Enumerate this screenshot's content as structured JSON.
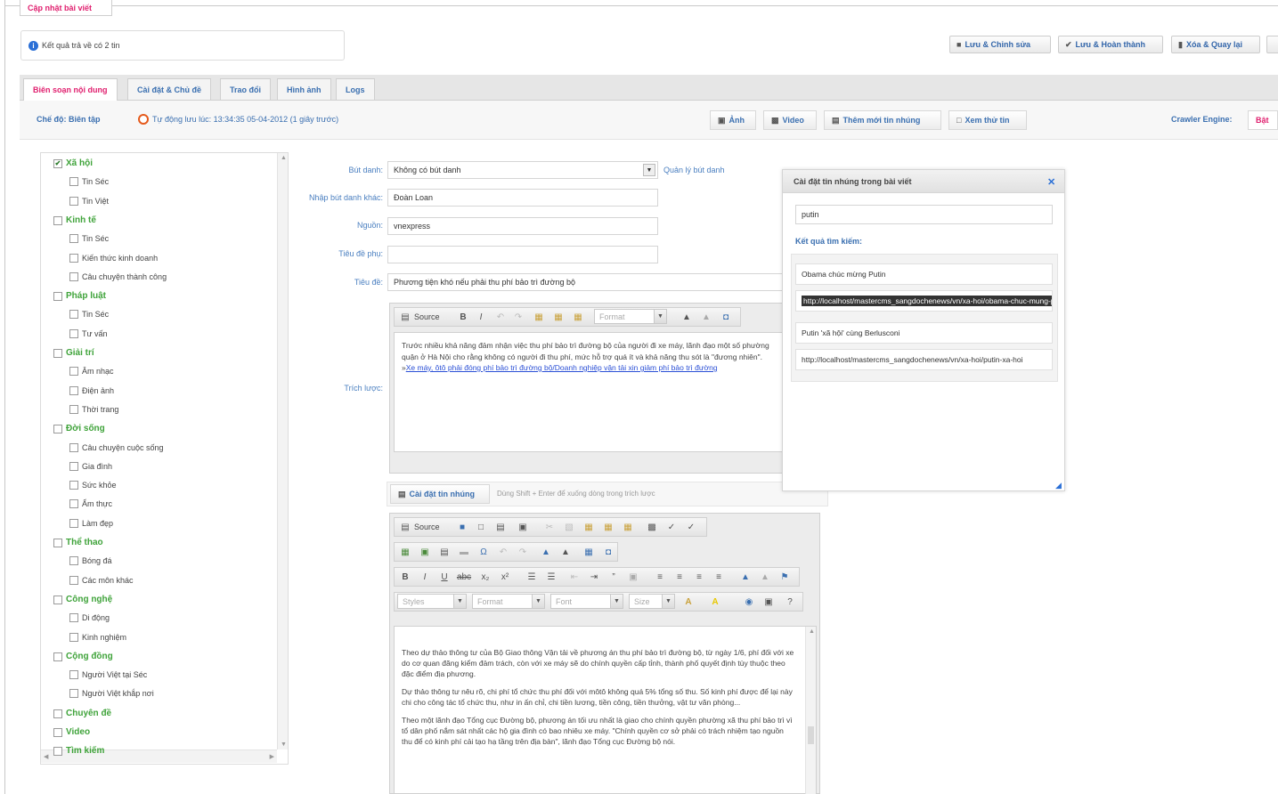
{
  "header": {
    "title": "Cập nhật bài viết"
  },
  "notice": {
    "text": "Kết quả trả về có 2 tin"
  },
  "actions": {
    "save_edit": "Lưu & Chỉnh sửa",
    "save_done": "Lưu & Hoàn thành",
    "delete_back": "Xóa & Quay lại"
  },
  "tabs": [
    {
      "label": "Biên soạn nội dung"
    },
    {
      "label": "Cài đặt & Chủ đề"
    },
    {
      "label": "Trao đổi"
    },
    {
      "label": "Hình ảnh"
    },
    {
      "label": "Logs"
    }
  ],
  "toolbar": {
    "mode_label": "Chế độ: Biên tập",
    "autosave": "Tự động lưu lúc: 13:34:35 05-04-2012 (1 giây trước)",
    "image_btn": "Ảnh",
    "video_btn": "Video",
    "add_embed_btn": "Thêm mới tin nhúng",
    "preview_btn": "Xem thử tin",
    "crawler_label": "Crawler Engine:",
    "crawler_state": "Bật"
  },
  "categories": [
    {
      "label": "Xã hội",
      "level": 0,
      "checked": true
    },
    {
      "label": "Tin Séc",
      "level": 1
    },
    {
      "label": "Tin Việt",
      "level": 1
    },
    {
      "label": "Kinh tế",
      "level": 0
    },
    {
      "label": "Tin Séc",
      "level": 1
    },
    {
      "label": "Kiến thức kinh doanh",
      "level": 1
    },
    {
      "label": "Câu chuyện thành công",
      "level": 1
    },
    {
      "label": "Pháp luật",
      "level": 0
    },
    {
      "label": "Tin Séc",
      "level": 1
    },
    {
      "label": "Tư vấn",
      "level": 1
    },
    {
      "label": "Giải trí",
      "level": 0
    },
    {
      "label": "Âm nhạc",
      "level": 1
    },
    {
      "label": "Điện ảnh",
      "level": 1
    },
    {
      "label": "Thời trang",
      "level": 1
    },
    {
      "label": "Đời sống",
      "level": 0
    },
    {
      "label": "Câu chuyện cuộc sống",
      "level": 1
    },
    {
      "label": "Gia đình",
      "level": 1
    },
    {
      "label": "Sức khỏe",
      "level": 1
    },
    {
      "label": "Ẩm thực",
      "level": 1
    },
    {
      "label": "Làm đẹp",
      "level": 1
    },
    {
      "label": "Thể thao",
      "level": 0
    },
    {
      "label": "Bóng đá",
      "level": 1
    },
    {
      "label": "Các môn khác",
      "level": 1
    },
    {
      "label": "Công nghệ",
      "level": 0
    },
    {
      "label": "Di động",
      "level": 1
    },
    {
      "label": "Kinh nghiệm",
      "level": 1
    },
    {
      "label": "Cộng đồng",
      "level": 0
    },
    {
      "label": "Người Việt tại Séc",
      "level": 1
    },
    {
      "label": "Người Việt khắp nơi",
      "level": 1
    },
    {
      "label": "Chuyên đề",
      "level": 0
    },
    {
      "label": "Video",
      "level": 0
    },
    {
      "label": "Tìm kiếm",
      "level": 0
    }
  ],
  "form": {
    "pen_label": "Bút danh:",
    "pen_value": "Không có bút danh",
    "pen_manage": "Quản lý bút danh",
    "other_pen_label": "Nhập bút danh khác:",
    "other_pen_value": "Đoàn Loan",
    "source_label": "Nguồn:",
    "source_value": "vnexpress",
    "subtitle_label": "Tiêu đề phụ:",
    "subtitle_value": "",
    "title_label": "Tiêu đề:",
    "title_value": "Phương tiện khó nếu phải thu phí bảo trì đường bộ",
    "summary_label": "Trích lược:"
  },
  "summary_editor": {
    "source_btn": "Source",
    "format_placeholder": "Format",
    "text": "Trước nhiều khả năng đảm nhận việc thu phí bảo trì đường bộ của người đi xe máy, lãnh đạo một số phường quận ở Hà Nội cho rằng không có người đi thu phí, mức hỗ trợ quá ít và khả năng thu sót là \"đương nhiên\". »",
    "link": "Xe máy, ôtô phải đóng phí bảo trì đường bộ/Doanh nghiệp vận tải xin giảm phí bảo trì đường"
  },
  "embed_bar": {
    "label": "Cài đặt tin nhúng",
    "hint": "Dùng Shift + Enter để xuống dòng trong trích lược"
  },
  "content_editor": {
    "source_btn": "Source",
    "styles": "Styles",
    "format": "Format",
    "font": "Font",
    "size": "Size",
    "paragraphs": [
      "Theo dự thảo thông tư của Bộ Giao thông Vận tải về phương án thu phí bảo trì đường bộ, từ ngày 1/6, phí đối với xe do cơ quan đăng kiểm đảm trách, còn với xe máy sẽ do chính quyền cấp tỉnh, thành phố quyết định tùy thuộc theo đặc điểm địa phương.",
      "Dự thảo thông tư nêu rõ, chi phí tổ chức thu phí đối với môtô không quá 5% tổng số thu. Số kinh phí được để lại này chi cho công tác tổ chức thu, như in ấn chỉ, chi tiền lương, tiền công, tiền thưởng, vật tư văn phòng...",
      "Theo một lãnh đạo Tổng cục Đường bộ, phương án tối ưu nhất là giao cho chính quyền phường xã thu phí bảo trì vì tổ dân phố nắm sát nhất các hộ gia đình có bao nhiêu xe máy. \"Chính quyền cơ sở phải có trách nhiệm tạo nguồn thu để có kinh phí cải tạo hạ tầng trên địa bàn\", lãnh đạo Tổng cục Đường bộ nói."
    ]
  },
  "embed_panel": {
    "title": "Cài đặt tin nhúng trong bài viết",
    "search_value": "putin",
    "results_label": "Kết quả tìm kiếm:",
    "results": [
      "Obama chúc mừng Putin",
      "http://localhost/mastercms_sangdochenews/vn/xa-hoi/obama-chuc-mung-putin",
      "Putin 'xã hội' cùng Berlusconi",
      "http://localhost/mastercms_sangdochenews/vn/xa-hoi/putin-xa-hoi"
    ]
  },
  "colors": {
    "accent_blue": "#3a6fb0",
    "accent_pink": "#e0206f",
    "category_green": "#3fa33a"
  }
}
